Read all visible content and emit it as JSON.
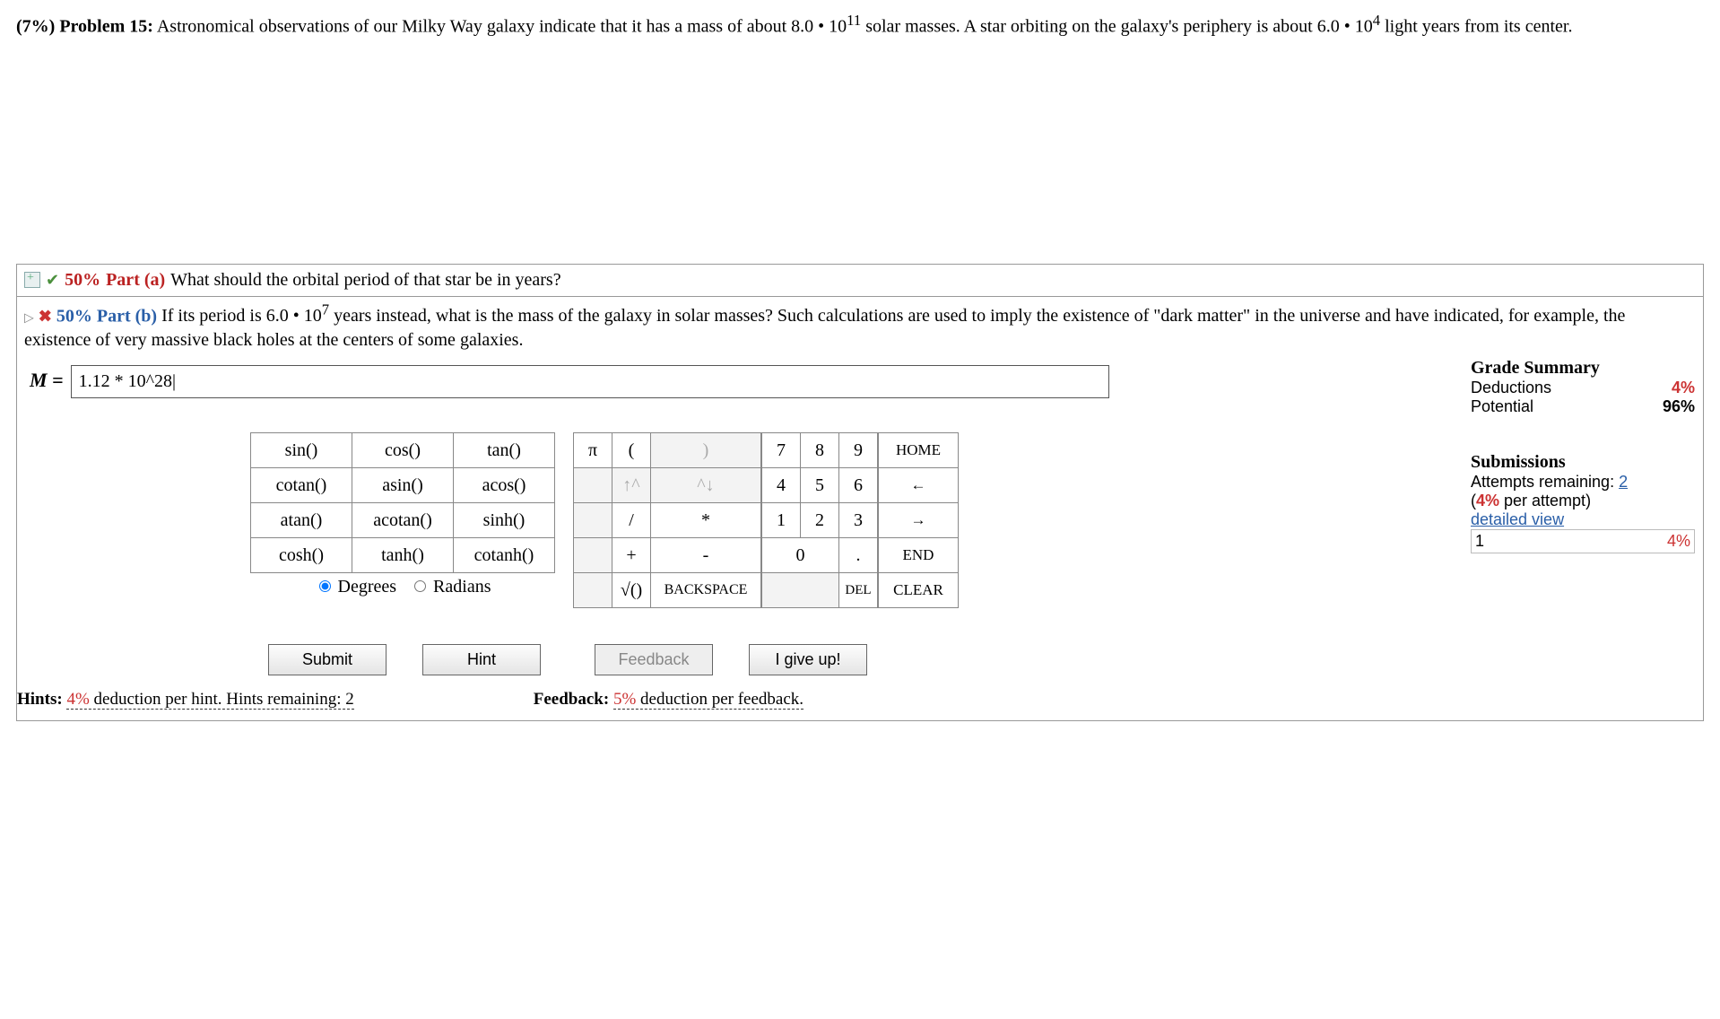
{
  "problem": {
    "weight": "(7%)",
    "label": "Problem 15:",
    "text_1": "Astronomical observations of our Milky Way galaxy indicate that it has a mass of about 8.0 • 10",
    "exp_1": "11",
    "text_2": " solar masses. A star orbiting on the galaxy's periphery is about 6.0 • 10",
    "exp_2": "4",
    "text_3": " light years from its center."
  },
  "part_a": {
    "percent": "50%",
    "label": "Part (a)",
    "text": "What should the orbital period of that star be in years?"
  },
  "part_b": {
    "percent": "50%",
    "label": "Part (b)",
    "text_1": "If its period is 6.0 • 10",
    "exp": "7",
    "text_2": " years instead, what is the mass of the galaxy in solar masses? Such calculations are used to imply the existence of \"dark matter\" in the universe and have indicated, for example, the existence of very massive black holes at the centers of some galaxies."
  },
  "answer": {
    "label": "M =",
    "value": "1.12 * 10^28|"
  },
  "grade": {
    "title": "Grade Summary",
    "deductions_label": "Deductions",
    "deductions_value": "4%",
    "potential_label": "Potential",
    "potential_value": "96%"
  },
  "submissions": {
    "title": "Submissions",
    "attempts_text": "Attempts remaining: ",
    "attempts_value": "2",
    "per_attempt": "(4% per attempt)",
    "detailed": "detailed view",
    "rows": [
      {
        "n": "1",
        "v": "4%"
      }
    ]
  },
  "funcs": [
    [
      "sin()",
      "cos()",
      "tan()"
    ],
    [
      "cotan()",
      "asin()",
      "acos()"
    ],
    [
      "atan()",
      "acotan()",
      "sinh()"
    ],
    [
      "cosh()",
      "tanh()",
      "cotanh()"
    ]
  ],
  "angle": {
    "degrees": "Degrees",
    "radians": "Radians"
  },
  "symcol": [
    [
      "π",
      "(",
      ")"
    ],
    [
      "",
      "↑^",
      "^↓"
    ],
    [
      "",
      "/",
      "*"
    ],
    [
      "",
      "+",
      "-"
    ],
    [
      "",
      "√()",
      ""
    ]
  ],
  "nums": [
    [
      "7",
      "8",
      "9"
    ],
    [
      "4",
      "5",
      "6"
    ],
    [
      "1",
      "2",
      "3"
    ]
  ],
  "num_zero": "0",
  "num_dot": ".",
  "nav": [
    "HOME",
    "←",
    "→",
    "END"
  ],
  "bottom_nav": {
    "backspace": "BACKSPACE",
    "del": "DEL",
    "clear": "CLEAR"
  },
  "actions": {
    "submit": "Submit",
    "hint": "Hint",
    "feedback": "Feedback",
    "giveup": "I give up!"
  },
  "hints": {
    "label": "Hints:",
    "pct": "4%",
    "text": "deduction per hint. Hints remaining: ",
    "remaining": "2"
  },
  "feedback": {
    "label": "Feedback:",
    "pct": "5%",
    "text": "deduction per feedback."
  }
}
